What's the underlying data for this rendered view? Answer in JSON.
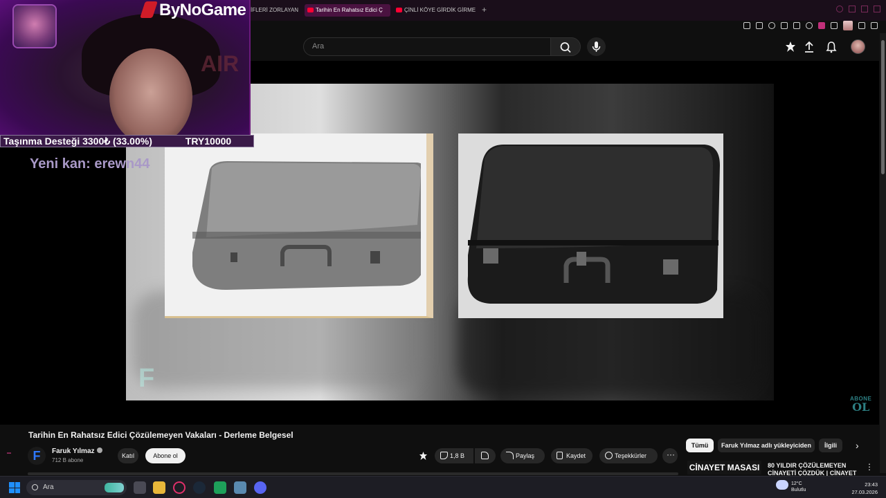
{
  "browser": {
    "tabs": [
      {
        "label": "İFLERİ ZORLAYAN",
        "active": false,
        "youtube": false
      },
      {
        "label": "Tarihin En Rahatsız Edici Ç",
        "active": true,
        "youtube": true
      },
      {
        "label": "ÇİNLİ KÖYE GİRDİK GİRME",
        "active": false,
        "youtube": true
      }
    ],
    "new_tab_label": "+"
  },
  "youtube": {
    "search_placeholder": "Ara",
    "accent_color": "#ff0033"
  },
  "stream_overlay": {
    "brand": "ByNoGame",
    "background_text": "AIR",
    "donation_label": "Taşınma Desteği 3300₺ (33.00%)",
    "donation_goal": "TRY10000",
    "donation_progress": 0.33,
    "new_member": "Yeni kan: erewn44"
  },
  "player": {
    "watermark_logo": "F",
    "subscribe_watermark_line1": "ABONE",
    "subscribe_watermark_line2": "OL"
  },
  "video": {
    "title": "Tarihin En Rahatsız Edici Çözülemeyen Vakaları - Derleme Belgesel",
    "channel_initial": "F",
    "channel_name": "Faruk Yılmaz",
    "subscribers": "712 B abone",
    "join_label": "Katıl",
    "subscribe_label": "Abone ol",
    "like_count": "1,8 B",
    "share_label": "Paylaş",
    "save_label": "Kaydet",
    "thanks_label": "Teşekkürler",
    "more_label": "···"
  },
  "sidebar": {
    "chips": [
      "Tümü",
      "Faruk Yılmaz adlı yükleyiciden",
      "İlgili"
    ],
    "selected_chip": 0,
    "recommendation": {
      "thumb_text": "CİNAYET MASASI",
      "title": "80 YILDIR ÇÖZÜLEMEYEN CİNAYETİ ÇÖZDÜK | CİNAYET"
    }
  },
  "taskbar": {
    "search_placeholder": "Ara",
    "weather_temp": "12°C",
    "weather_desc": "Bulutlu",
    "time": "23:43",
    "date": "27.03.2026"
  }
}
